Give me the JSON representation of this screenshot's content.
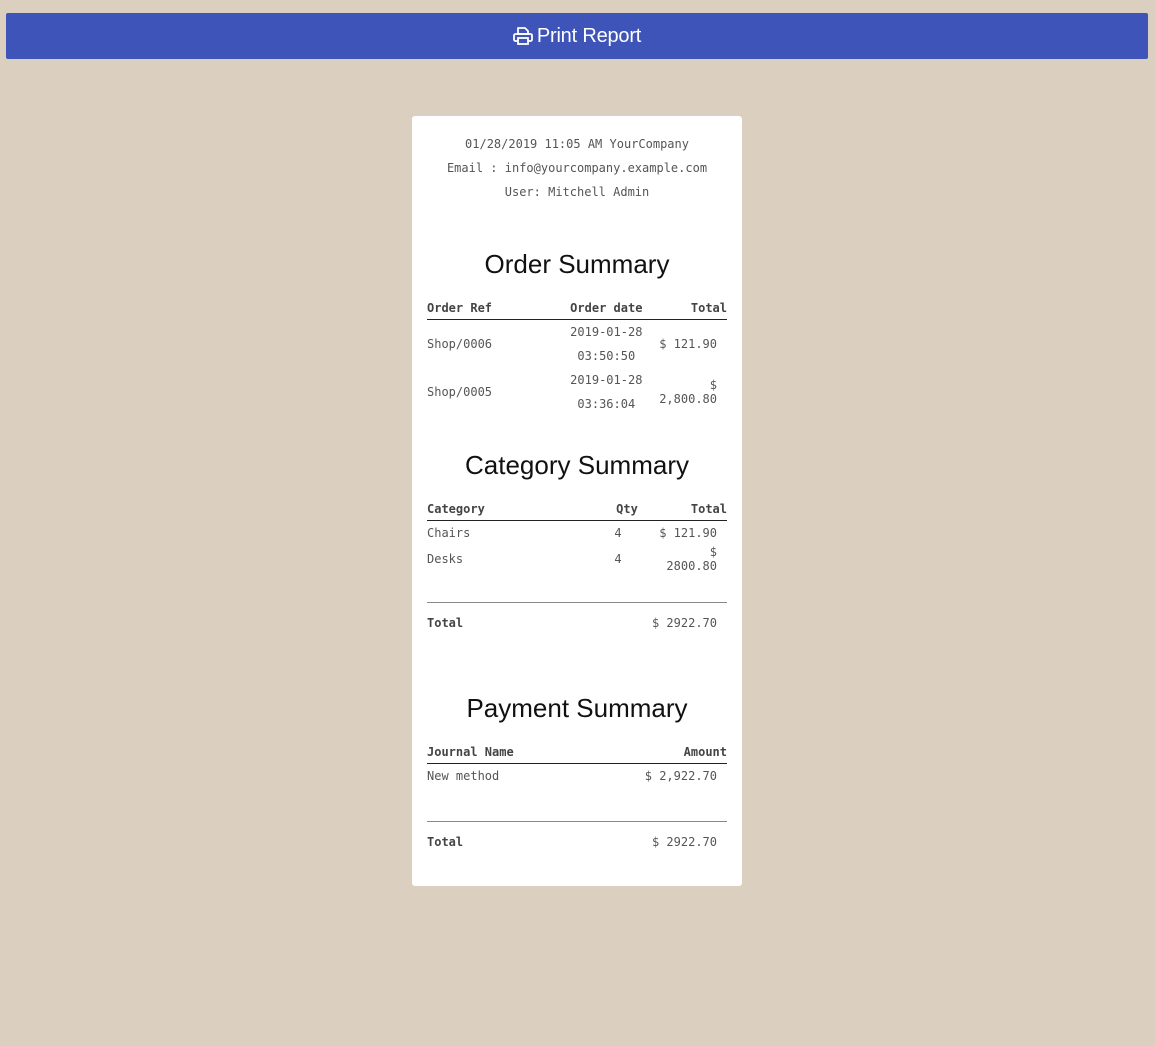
{
  "print_button": {
    "label": "Print Report",
    "icon": "printer-icon"
  },
  "receipt": {
    "header": {
      "line1": "01/28/2019 11:05 AM YourCompany",
      "line2": "Email : info@yourcompany.example.com",
      "line3": "User: Mitchell Admin"
    },
    "order_summary": {
      "title": "Order Summary",
      "columns": [
        "Order Ref",
        "Order date",
        "Total"
      ],
      "rows": [
        {
          "ref": "Shop/0006",
          "date_line1": "2019-01-28",
          "date_line2": "03:50:50",
          "total": "$ 121.90"
        },
        {
          "ref": "Shop/0005",
          "date_line1": "2019-01-28",
          "date_line2": "03:36:04",
          "total": "$ 2,800.80"
        }
      ]
    },
    "category_summary": {
      "title": "Category Summary",
      "columns": [
        "Category",
        "Qty",
        "Total"
      ],
      "rows": [
        {
          "category": "Chairs",
          "qty": "4",
          "total": "$ 121.90"
        },
        {
          "category": "Desks",
          "qty": "4",
          "total": "$ 2800.80"
        }
      ],
      "total_label": "Total",
      "total_value": "$ 2922.70"
    },
    "payment_summary": {
      "title": "Payment Summary",
      "columns": [
        "Journal Name",
        "Amount"
      ],
      "rows": [
        {
          "journal": "New method",
          "amount": "$ 2,922.70"
        }
      ],
      "total_label": "Total",
      "total_value": "$ 2922.70"
    }
  },
  "colors": {
    "background": "#dbcfbf",
    "button": "#3e54b8",
    "receipt": "#ffffff"
  }
}
